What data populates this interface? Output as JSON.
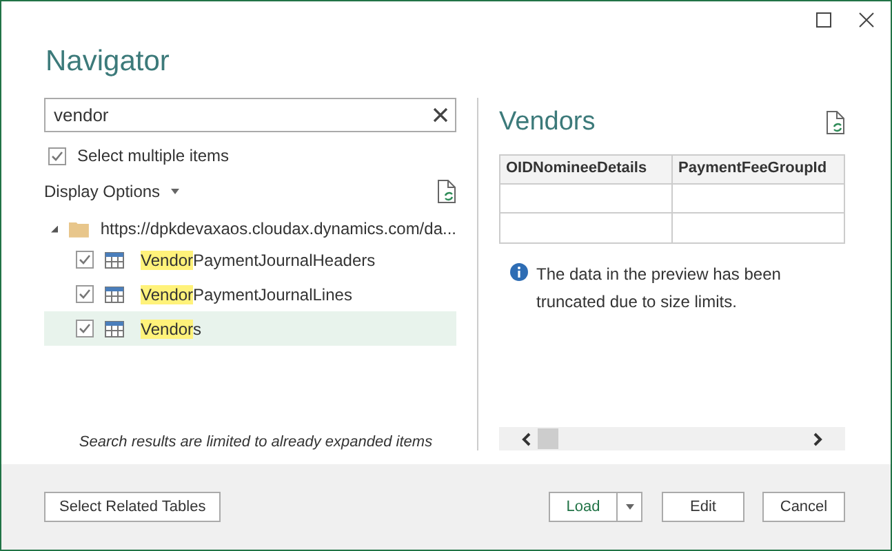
{
  "window": {
    "title": "Navigator"
  },
  "search": {
    "value": "vendor"
  },
  "select_multiple": {
    "label": "Select multiple items",
    "checked": true
  },
  "display_options": {
    "label": "Display Options"
  },
  "tree": [
    {
      "label": "https://dpkdevaxaos.cloudax.dynamics.com/da...",
      "expanded": true,
      "children": [
        {
          "match": "Vendor",
          "rest": "PaymentJournalHeaders",
          "checked": true,
          "selected": false
        },
        {
          "match": "Vendor",
          "rest": "PaymentJournalLines",
          "checked": true,
          "selected": false
        },
        {
          "match": "Vendor",
          "rest": "s",
          "checked": true,
          "selected": true
        }
      ]
    }
  ],
  "search_note": "Search results are limited to already expanded items",
  "preview": {
    "title": "Vendors",
    "columns": [
      "OIDNomineeDetails",
      "PaymentFeeGroupId"
    ],
    "info": "The data in the preview has been truncated due to size limits."
  },
  "footer": {
    "select_related": "Select Related Tables",
    "load": "Load",
    "edit": "Edit",
    "cancel": "Cancel"
  }
}
